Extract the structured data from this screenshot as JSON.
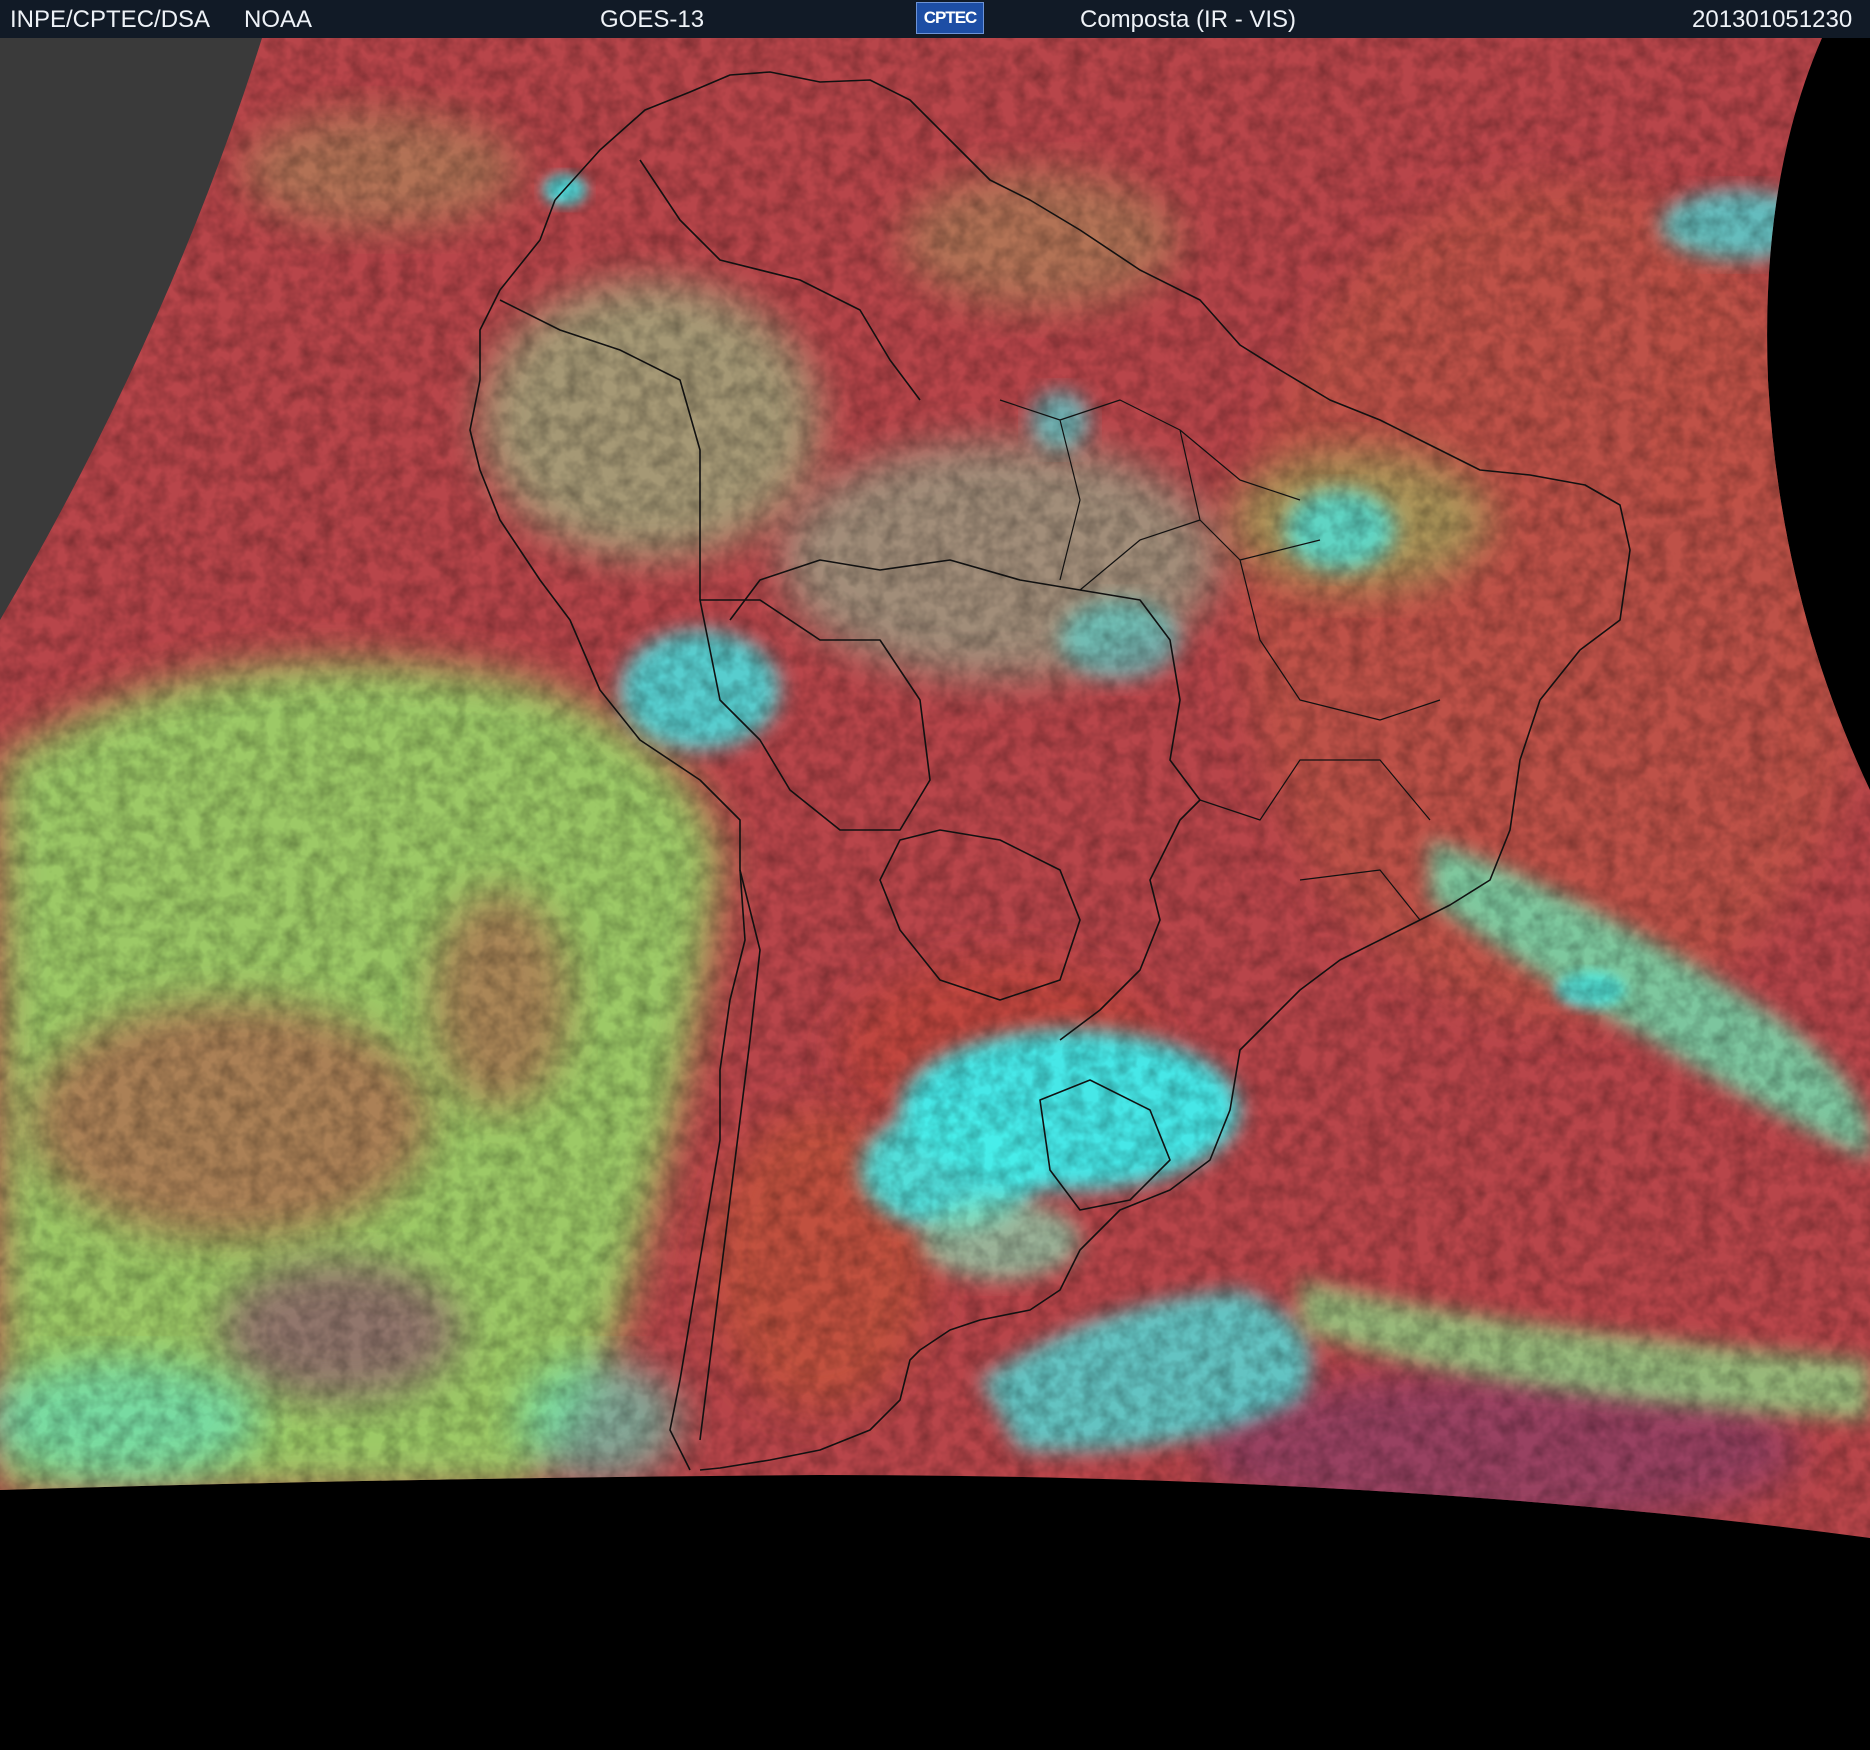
{
  "header": {
    "agency": "INPE/CPTEC/DSA",
    "source": "NOAA",
    "satellite": "GOES-13",
    "logo_text": "CPTEC",
    "product": "Composta (IR - VIS)",
    "timestamp": "201301051230"
  },
  "colors": {
    "header_bg": "#111a26",
    "dry_surface": "#b8454a",
    "low_cloud": "#9ad86a",
    "high_cloud": "#3ff0f0",
    "space": "#000000",
    "off_disk": "#3a3a3a",
    "border_lines": "#111111"
  }
}
